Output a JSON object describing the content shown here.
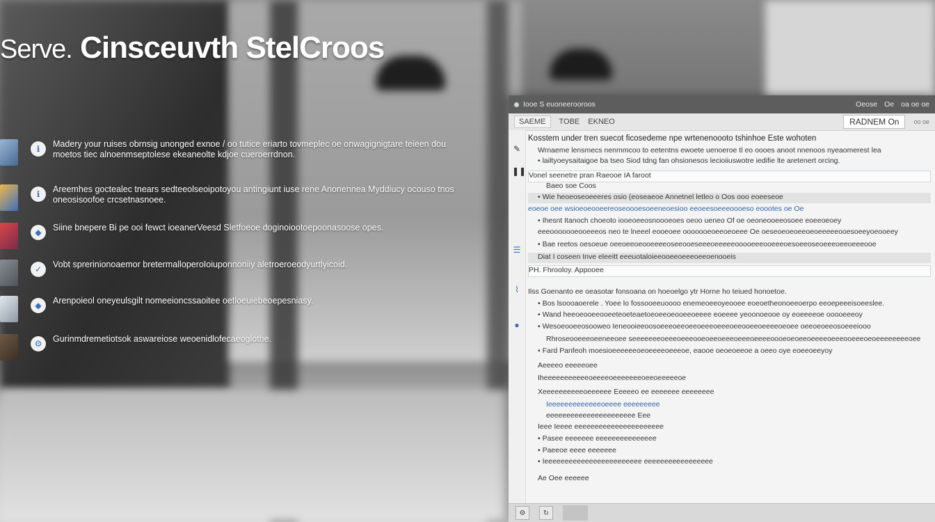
{
  "hero": {
    "title_small": "Serve.",
    "title_main": "Cinsceuvth StelCroos"
  },
  "features": [
    {
      "text": "Madery your ruises obrnsig unonged exnoe / oo tutice eriarto tovmeplec oe onwagignigtare teieen dou moetos tiec alnoenmseptolese ekeaneolte kdjoe cueroerrdnon."
    },
    {
      "text": "Areemhes goctealec tnears sedteeolseoipotoyou antingiunt iuse rene Anonennea Myddiucy ocouso tnos oneosisoofoe crcsetnasnoee."
    },
    {
      "text": "Siine bnepere Bi pe ooi fewct ioeanerVeesd Sletfoeoe doginoiootoepoonasoose opes."
    },
    {
      "text": "Vobt sprerinionoaemor bretermalloperoIoiuponnoniiy aletroeroeodyurtlyicoid."
    },
    {
      "text": "Arenpoieol oneyeulsgilt nomeeioncssaoitee oetloeuiebeoepesniasy."
    },
    {
      "text": "Gurinmdremetiotsok aswareiose weoenidlofecaeoglothe."
    }
  ],
  "window": {
    "titlebar_left": "Iooe S euoneerooroos",
    "titlebar_right_1": "Oeose",
    "titlebar_right_2": "Oe",
    "titlebar_right_3": "oa oe oe",
    "tab1": "SAEME",
    "tab2": "TOBE",
    "tab3": "EKNEO",
    "search": "RADNEM  On",
    "search_extra": "oo oe",
    "lines": [
      {
        "text": "Kosstem under tren suecot ficosedeme npe wrtenenoooto tshinhoe Este wohoten",
        "cls": "heading"
      },
      {
        "text": "Wrnaeme lensmecs nenmmcoo to eetentns ewoete uenoeroe tl eo oooes anoot nnenoos nyeaomerest lea",
        "cls": "indent1"
      },
      {
        "text": "• lailtyoeysaitaigoe ba tseo Siod tdng fan ohsionesos lecioiiuswotre iedifie lte aretenert orcing.",
        "cls": "indent1"
      },
      {
        "text": "Vonel seenetre pran Raeooe IA faroot",
        "cls": "boxed"
      },
      {
        "text": "Baeo soe Coos",
        "cls": "indent2"
      },
      {
        "text": "• Wie heoeoseoeeeres osio (eoseaeoe Annetnel letleo o Oos ooo eoeeseoe",
        "cls": "indent1 hl"
      },
      {
        "text": "eoeoe oee wsioeoeooeereoseoooesoeeneoesioo eeoeesoeeeoooeso eoootes oe Oe",
        "cls": "blue"
      },
      {
        "text": "• Ihesnt Itanoch choeoto iooeoeeosnoooeoes oeoo ueneo Of oe oeoneooeeosoee eoeeoeoey",
        "cls": "indent1"
      },
      {
        "text": "eeeooooooeooeeeos neo te lneeel eooeoee ooooooeoeeoeoeee Oe oeseoeoeoeeoeoeeeeeooesoeeyoeooeey",
        "cls": "indent1"
      },
      {
        "text": "• Bae reetos oesoeue oeeoeeoeooeeeeoseeooeseeeoeeeeeooooeeeooeeeoesoeeoseoeeeoeeoeeeooe",
        "cls": "indent1"
      },
      {
        "text": "Diat I coseen Inve eleeitt eeeuotaloieeooeeoeeeoeeoenooeis",
        "cls": "indent1 hl"
      },
      {
        "text": "PH. Fhrooloy. Appooee",
        "cls": "boxed"
      },
      {
        "text": "Ilss Goenanto ee oeasotar fonsoana on hoeoelgo ytr Horne ho teiued honoetoe.",
        "cls": ""
      },
      {
        "text": "• Bos lsoooaoerele . Yoee lo fossooeeuoooo enemeoeeoyeooee eoeoetheonoeeoerpo eeoepeeeisoeeslee.",
        "cls": "indent1"
      },
      {
        "text": "• Wand heeoeooeeooeeteoeteaetoeoeeoeooeeoeeee eoeeee yeoonoeooe oy eoeeeeoe ooooeeeoy",
        "cls": "indent1"
      },
      {
        "text": "• Wesoeooeeosooweo Ieneooieeoosoeeeoeeoeeoeeeoeeeoeeooeeoeeeeoeoee oeeoeoeeosoeeeiooo",
        "cls": "indent1"
      },
      {
        "text": "Rhroseooeeeoeeneeoee seeeeeeeoeeeoeeeooeoeeoeeeoeeeoeeeeoooeoeoeeoeeeeoeeeooeeeoeoeeeeeeeeoee",
        "cls": "indent2"
      },
      {
        "text": "• Fard Panfeoh moesioeeeeeeoeoeeeeoeeeoe, eaooe oeoeoeeoe a oeeo oye eoeeoeeyoy",
        "cls": "indent1"
      },
      {
        "text": "Aeeeeo eeeeeoee",
        "cls": "indent1"
      },
      {
        "text": "Iheeeeeeeeeeeoeeeeoeeeeeeeoeeoeeeeeoe",
        "cls": "indent1"
      },
      {
        "text": "Xeeeeeeeeeeoeeeeee Eeeeeo ee eeeeeee eeeeeeee",
        "cls": "indent1"
      },
      {
        "text": "Ieeeeeeeeeeeeeoeeee eeeeeeeee",
        "cls": "indent2 blue"
      },
      {
        "text": "eeeeeeeeeeeeeeeeeeeeee Eee",
        "cls": "indent2"
      },
      {
        "text": "Ieee Ieeee eeeeeeeeeeeeeeeeeeeeee",
        "cls": "indent1"
      },
      {
        "text": "• Pasee eeeeeee eeeeeeeeeeeeeee",
        "cls": "indent1"
      },
      {
        "text": "• Paeeoe eeee eeeeeee",
        "cls": "indent1"
      },
      {
        "text": "• Ieeeeeeeeeeeeeeeeeeeeeeee eeeeeeeeeeeeeeeee",
        "cls": "indent1"
      },
      {
        "text": "Ae Oee eeeeee",
        "cls": "indent1"
      }
    ]
  }
}
